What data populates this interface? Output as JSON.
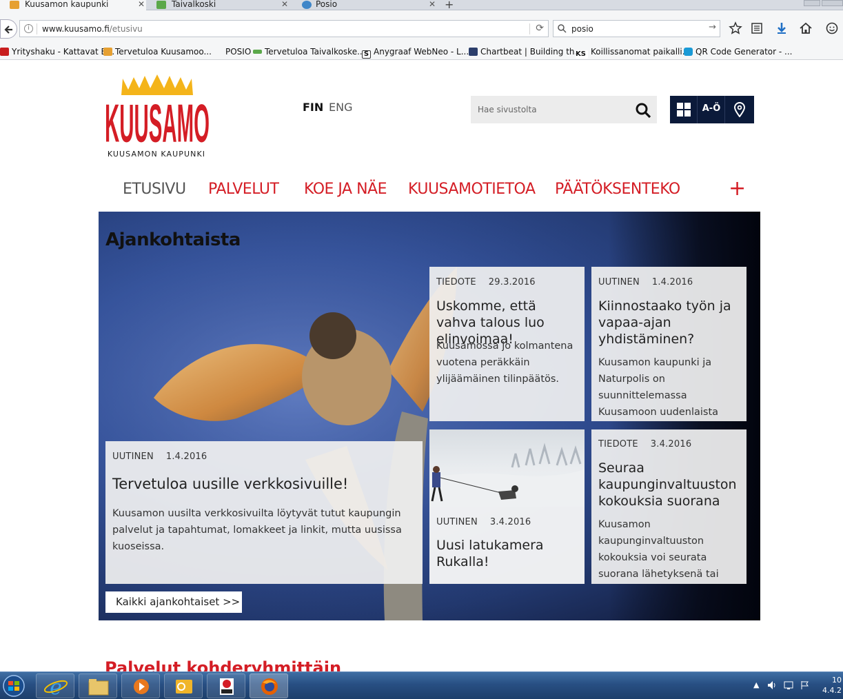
{
  "browser": {
    "tabs": [
      {
        "title": "Kuusamon kaupunki",
        "active": true
      },
      {
        "title": "Taivalkoski",
        "active": false
      },
      {
        "title": "Posio",
        "active": false
      }
    ],
    "url_host": "www.kuusamo.fi",
    "url_path": "/etusivu",
    "search_query": "posio",
    "bookmarks": [
      "Yrityshaku - Kattavat B...",
      "Tervetuloa Kuusamoo...",
      "POSIO",
      "Tervetuloa Taivalkoske...",
      "Anygraaf WebNeo - L...",
      "Chartbeat | Building th...",
      "Koillissanomat paikalli...",
      "QR Code Generator - ..."
    ]
  },
  "site": {
    "logo_word": "KUUSAMO",
    "logo_subtitle": "KUUSAMON KAUPUNKI",
    "lang_fin": "FIN",
    "lang_eng": "ENG",
    "search_placeholder": "Hae sivustolta",
    "quick_az": "A-Ö",
    "nav": [
      "ETUSIVU",
      "PALVELUT",
      "KOE JA NÄE",
      "KUUSAMOTIETOA",
      "PÄÄTÖKSENTEKO"
    ],
    "nav_more": "+"
  },
  "hero": {
    "title": "Ajankohtaista",
    "main_card": {
      "type": "UUTINEN",
      "date": "1.4.2016",
      "heading": "Tervetuloa uusille verkkosivuille!",
      "text": "Kuusamon uusilta verkkosivuilta löytyvät tutut kaupungin palvelut ja tapahtumat, lomakkeet ja linkit, mutta uusissa kuoseissa."
    },
    "cards": [
      {
        "type": "TIEDOTE",
        "date": "29.3.2016",
        "heading": "Uskomme, että vahva talous luo elinvoimaa!",
        "text": "Kuusamossa jo kolmantena vuotena peräkkäin ylijäämäinen tilinpäätös."
      },
      {
        "type": "UUTINEN",
        "date": "1.4.2016",
        "heading": "Kiinnostaako työn ja vapaa-ajan yhdistäminen?",
        "text": "Kuusamon kaupunki ja Naturpolis on suunnittelemassa Kuusamoon uudenlaista"
      },
      {
        "type": "UUTINEN",
        "date": "3.4.2016",
        "heading": "Uusi latukamera Rukalla!",
        "text": ""
      },
      {
        "type": "TIEDOTE",
        "date": "3.4.2016",
        "heading": "Seuraa kaupunginvaltuuston kokouksia suorana",
        "text": "Kuusamon kaupunginvaltuuston kokouksia voi seurata suorana lähetyksenä tai"
      }
    ],
    "all_news": "Kaikki ajankohtaiset  >>"
  },
  "section_title": "Palvelut kohderyhmittäin",
  "taskbar": {
    "clock_time": "10",
    "clock_date": "4.4.2"
  },
  "colors": {
    "brand_red": "#d41d25",
    "logo_yellow": "#f4b41a",
    "quick_bg": "#0b1a3a"
  }
}
